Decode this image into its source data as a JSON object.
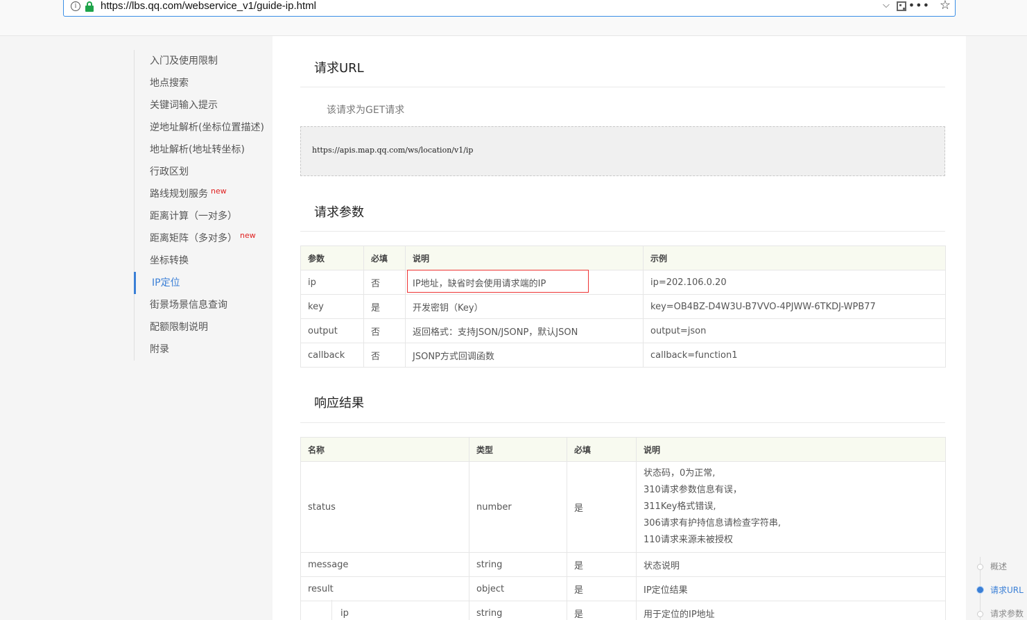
{
  "browser": {
    "url": "https://lbs.qq.com/webservice_v1/guide-ip.html",
    "info_glyph": "i",
    "dropdown_glyph": "⌵",
    "menu_glyph": "•••",
    "bookmark_glyph": "☆"
  },
  "sidebar": {
    "items": [
      {
        "label": "入门及使用限制"
      },
      {
        "label": "地点搜索"
      },
      {
        "label": "关键词输入提示"
      },
      {
        "label": "逆地址解析(坐标位置描述)"
      },
      {
        "label": "地址解析(地址转坐标)"
      },
      {
        "label": "行政区划"
      },
      {
        "label": "路线规划服务",
        "badge": "new"
      },
      {
        "label": "距离计算（一对多）"
      },
      {
        "label": "距离矩阵（多对多）",
        "badge": "new"
      },
      {
        "label": "坐标转换"
      },
      {
        "label": "IP定位"
      },
      {
        "label": "街景场景信息查询"
      },
      {
        "label": "配额限制说明"
      },
      {
        "label": "附录"
      }
    ],
    "active_index": 10
  },
  "main": {
    "request_url": {
      "title": "请求URL",
      "note": "该请求为GET请求",
      "code": "https://apis.map.qq.com/ws/location/v1/ip"
    },
    "request_params": {
      "title": "请求参数",
      "headers": [
        "参数",
        "必填",
        "说明",
        "示例"
      ],
      "rows": [
        [
          "ip",
          "否",
          "IP地址，缺省时会使用请求端的IP",
          " ip=202.106.0.20"
        ],
        [
          "key",
          "是",
          "开发密钥（Key）",
          "key=OB4BZ-D4W3U-B7VVO-4PJWW-6TKDJ-WPB77"
        ],
        [
          "output",
          "否",
          "返回格式：支持JSON/JSONP，默认JSON",
          "output=json"
        ],
        [
          "callback",
          "否",
          "JSONP方式回调函数",
          "callback=function1"
        ]
      ]
    },
    "response": {
      "title": "响应结果",
      "headers": [
        "名称",
        "类型",
        "必填",
        "说明"
      ],
      "status_row": {
        "name": "status",
        "type": "number",
        "required": "是",
        "desc": [
          "状态码，0为正常,",
          "310请求参数信息有误，",
          "311Key格式错误,",
          "306请求有护持信息请检查字符串,",
          "110请求来源未被授权"
        ]
      },
      "rows": [
        [
          "message",
          "string",
          "是",
          "状态说明"
        ],
        [
          "result",
          "object",
          "是",
          "IP定位结果"
        ]
      ],
      "sub_row": [
        "ip",
        "string",
        "是",
        "用于定位的IP地址"
      ]
    }
  },
  "right_nav": {
    "items": [
      "概述",
      "请求URL",
      "请求参数"
    ],
    "active_index": 1
  },
  "colors": {
    "accent": "#3a7fd6",
    "badge": "#e02020",
    "highlight_box": "#ee3333",
    "table_header_bg": "#f8faf0"
  }
}
